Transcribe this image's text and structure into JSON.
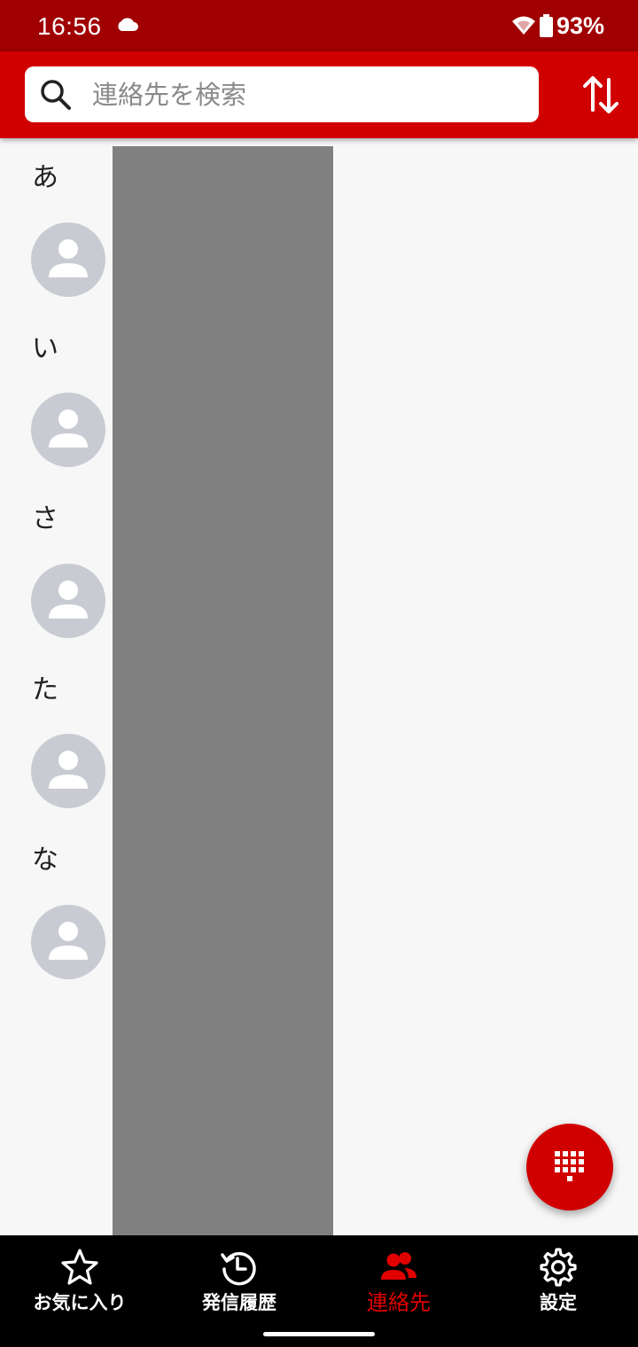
{
  "status_bar": {
    "time": "16:56",
    "battery": "93%",
    "icons": [
      "cloud-icon",
      "wifi-icon",
      "battery-icon"
    ]
  },
  "search": {
    "placeholder": "連絡先を検索",
    "value": ""
  },
  "colors": {
    "accent": "#d10000",
    "status_bar": "#a00000",
    "avatar_bg": "#c9cbd3",
    "nav_bg": "#000000"
  },
  "contacts": {
    "sections": [
      {
        "header": "あ"
      },
      {
        "header": "い"
      },
      {
        "header": "さ"
      },
      {
        "header": "た"
      },
      {
        "header": "な"
      }
    ]
  },
  "bottom_nav": {
    "items": [
      {
        "label": "お気に入り",
        "icon": "star-icon"
      },
      {
        "label": "発信履歴",
        "icon": "history-icon"
      },
      {
        "label": "連絡先",
        "icon": "contacts-icon",
        "active": true
      },
      {
        "label": "設定",
        "icon": "gear-icon"
      }
    ]
  }
}
